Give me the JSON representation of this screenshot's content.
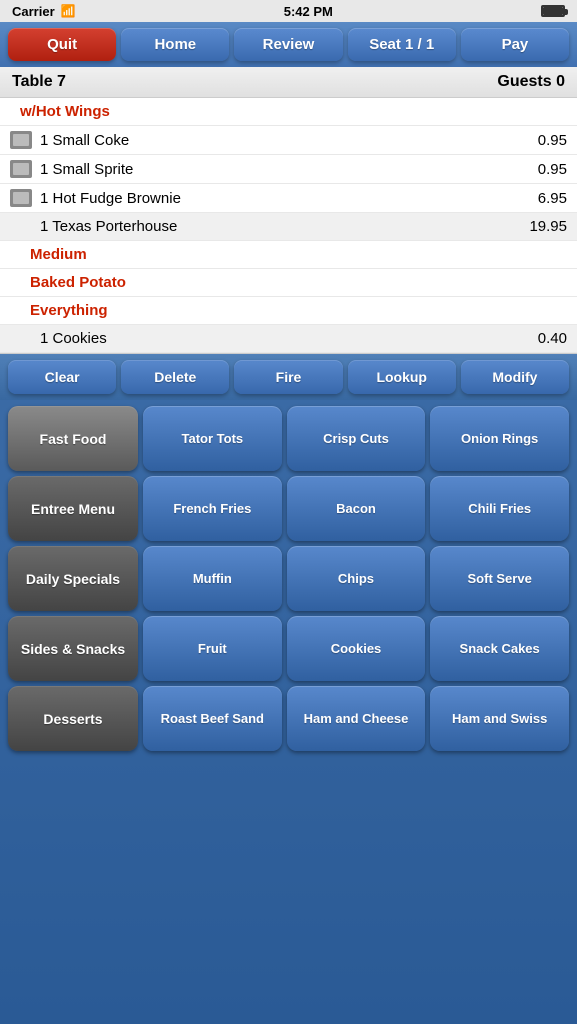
{
  "statusBar": {
    "carrier": "Carrier",
    "time": "5:42 PM"
  },
  "nav": {
    "quit": "Quit",
    "home": "Home",
    "review": "Review",
    "seat": "Seat 1 / 1",
    "pay": "Pay"
  },
  "tableBar": {
    "table": "Table 7",
    "guests": "Guests 0"
  },
  "orderItems": [
    {
      "id": 1,
      "type": "modifier-red",
      "name": "w/Hot Wings",
      "price": ""
    },
    {
      "id": 2,
      "type": "item",
      "icon": true,
      "name": "1 Small Coke",
      "price": "0.95"
    },
    {
      "id": 3,
      "type": "item",
      "icon": true,
      "name": "1 Small Sprite",
      "price": "0.95"
    },
    {
      "id": 4,
      "type": "item",
      "icon": true,
      "name": "1 Hot Fudge Brownie",
      "price": "6.95"
    },
    {
      "id": 5,
      "type": "item-shaded",
      "icon": false,
      "name": "1 Texas Porterhouse",
      "price": "19.95"
    },
    {
      "id": 6,
      "type": "modifier-red",
      "name": "Medium",
      "price": ""
    },
    {
      "id": 7,
      "type": "modifier-red",
      "name": "Baked Potato",
      "price": ""
    },
    {
      "id": 8,
      "type": "modifier-red",
      "name": "Everything",
      "price": ""
    },
    {
      "id": 9,
      "type": "item-shaded",
      "icon": false,
      "name": "1 Cookies",
      "price": "0.40"
    }
  ],
  "actionButtons": [
    "Clear",
    "Delete",
    "Fire",
    "Lookup",
    "Modify"
  ],
  "categories": [
    {
      "id": "fast-food",
      "label": "Fast Food",
      "active": true
    },
    {
      "id": "entree-menu",
      "label": "Entree Menu",
      "active": false
    },
    {
      "id": "daily-specials",
      "label": "Daily Specials",
      "active": false
    },
    {
      "id": "sides-snacks",
      "label": "Sides & Snacks",
      "active": false
    },
    {
      "id": "desserts",
      "label": "Desserts",
      "active": false
    }
  ],
  "menuRows": [
    [
      "Tator Tots",
      "Crisp Cuts",
      "Onion Rings"
    ],
    [
      "French Fries",
      "Bacon",
      "Chili Fries"
    ],
    [
      "Muffin",
      "Chips",
      "Soft Serve"
    ],
    [
      "Fruit",
      "Cookies",
      "Snack Cakes"
    ],
    [
      "Roast Beef Sand",
      "Ham and Cheese",
      "Ham and Swiss"
    ]
  ]
}
